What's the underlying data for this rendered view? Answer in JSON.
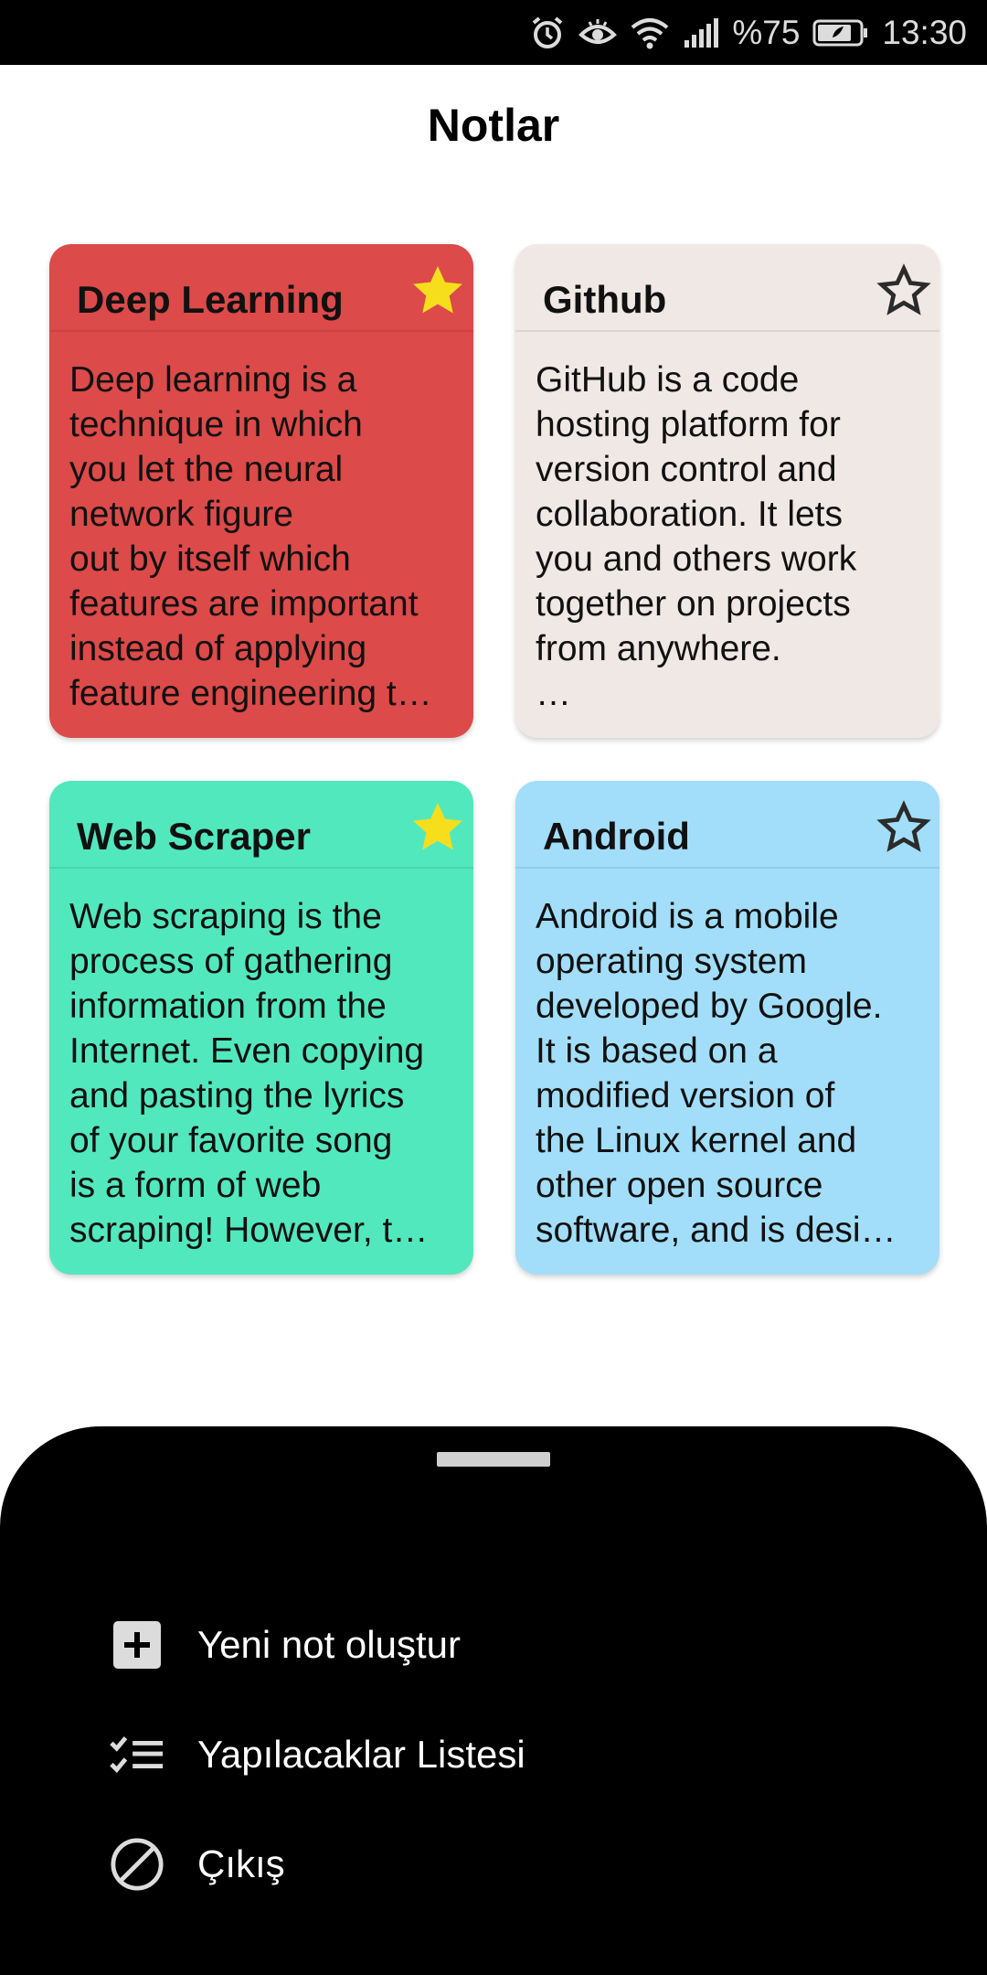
{
  "status_bar": {
    "battery_text": "%75",
    "time": "13:30"
  },
  "header": {
    "title": "Notlar"
  },
  "notes": [
    {
      "title": "Deep Learning",
      "body": "Deep learning is a\ntechnique in which\nyou let the neural\nnetwork figure\nout by itself which\nfeatures are important\ninstead of applying\nfeature engineering t…",
      "favorite": true,
      "color": "#dc4a49"
    },
    {
      "title": "Github",
      "body": "GitHub is a code\nhosting platform for\nversion control and\ncollaboration. It lets\nyou and others work\ntogether on projects\nfrom anywhere.\n…",
      "favorite": false,
      "color": "#f0e8e4"
    },
    {
      "title": "Web Scraper",
      "body": "Web scraping is the\nprocess of gathering\ninformation from the\nInternet. Even copying\nand pasting the lyrics\nof your favorite song\nis a form of web\nscraping! However, t…",
      "favorite": true,
      "color": "#52e8bd"
    },
    {
      "title": "Android",
      "body": "Android is a mobile\noperating system\ndeveloped by Google.\nIt is based on a\nmodified version of\nthe Linux kernel and\nother open source\nsoftware, and is desi…",
      "favorite": false,
      "color": "#a2def9"
    }
  ],
  "bottom_sheet": {
    "items": [
      {
        "label": "Yeni not oluştur",
        "icon": "add-box-icon"
      },
      {
        "label": "Yapılacaklar Listesi",
        "icon": "checklist-icon"
      },
      {
        "label": "Çıkış",
        "icon": "block-icon"
      }
    ]
  },
  "colors": {
    "star_filled": "#f6de1c",
    "star_outline": "#2b2b2b",
    "sheet_background": "#000000"
  }
}
